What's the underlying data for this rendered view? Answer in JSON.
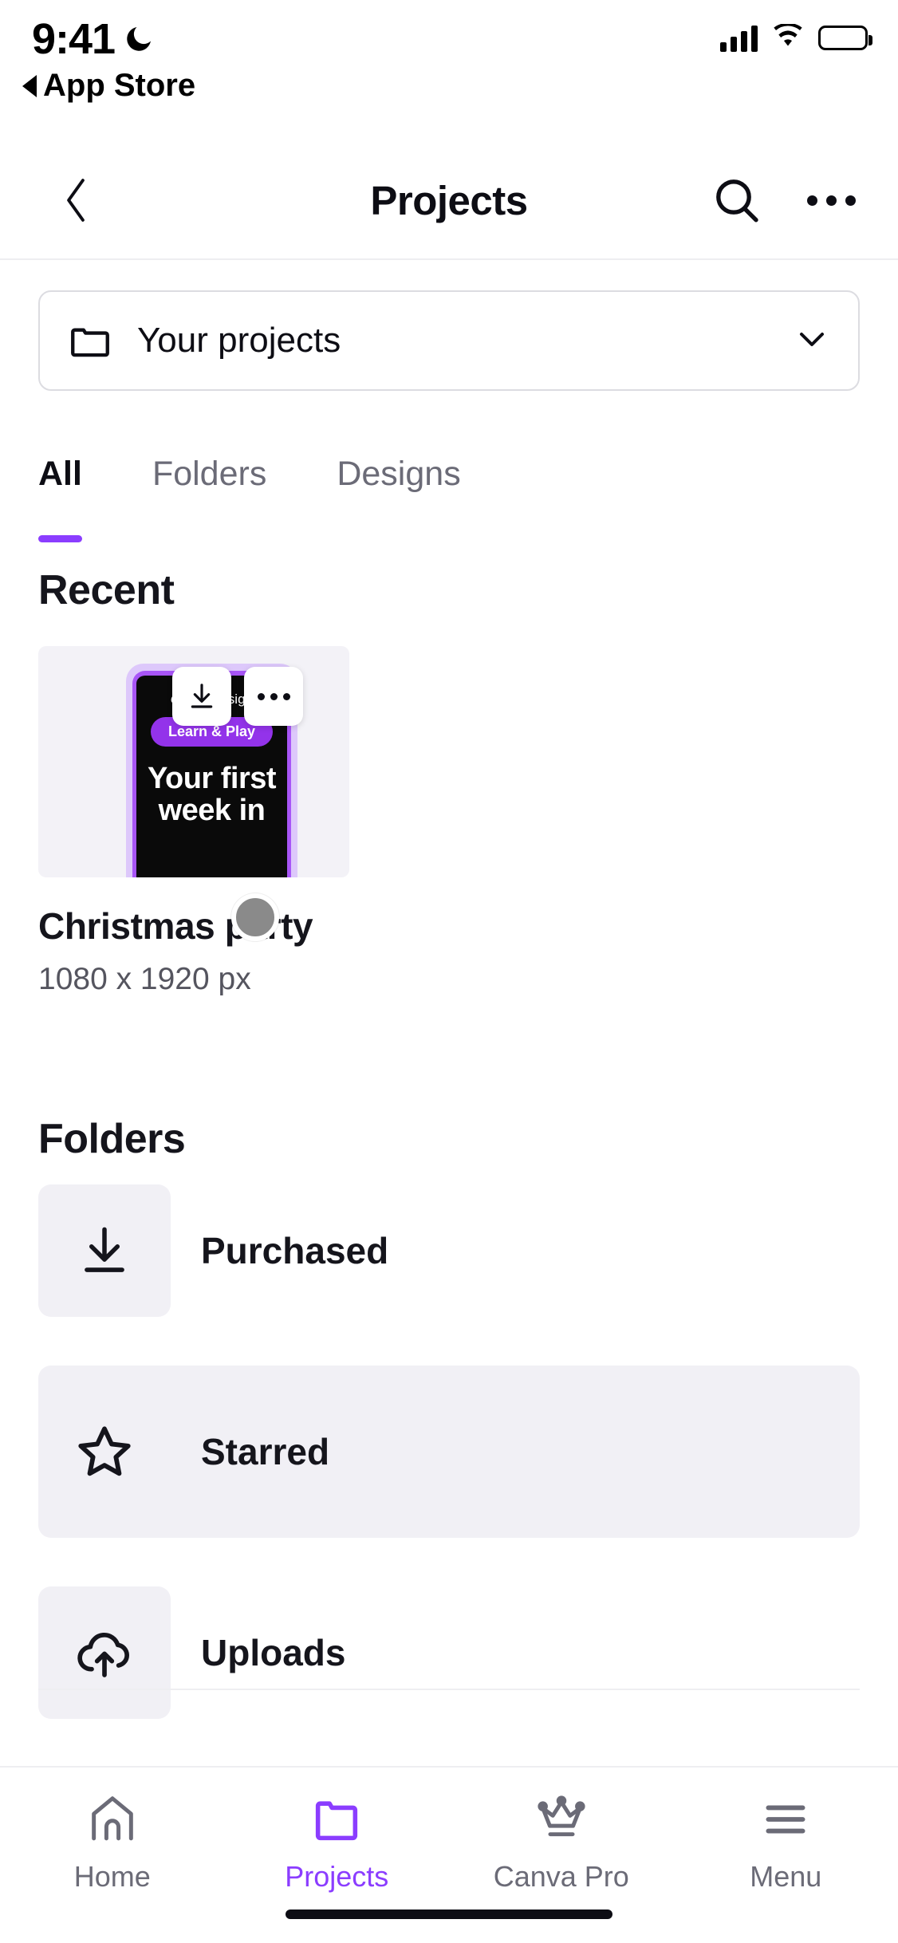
{
  "status_bar": {
    "time": "9:41",
    "dnd_icon": "crescent-moon-icon",
    "back_label": "App Store",
    "signal_icon": "cellular-signal-icon",
    "wifi_icon": "wifi-icon",
    "battery_icon": "battery-full-icon"
  },
  "header": {
    "back_icon": "chevron-left-icon",
    "title": "Projects",
    "search_icon": "search-icon",
    "more_icon": "more-horizontal-icon"
  },
  "dropdown": {
    "icon": "folder-icon",
    "label": "Your projects",
    "chevron_icon": "chevron-down-icon"
  },
  "tabs": [
    {
      "label": "All",
      "active": true
    },
    {
      "label": "Folders",
      "active": false
    },
    {
      "label": "Designs",
      "active": false
    }
  ],
  "recent": {
    "section_title": "Recent",
    "card": {
      "title": "Christmas party",
      "dimensions": "1080 x 1920 px",
      "download_icon": "download-icon",
      "more_icon": "more-horizontal-icon",
      "thumbnail": {
        "brand_italic": "Canva",
        "brand_rest": " Design",
        "pill_label": "Learn & Play",
        "headline_line1": "Your first",
        "headline_line2": "week in"
      }
    }
  },
  "folders": {
    "section_title": "Folders",
    "items": [
      {
        "label": "Purchased",
        "icon": "download-icon",
        "selected": false
      },
      {
        "label": "Starred",
        "icon": "star-icon",
        "selected": true
      },
      {
        "label": "Uploads",
        "icon": "cloud-upload-icon",
        "selected": false
      }
    ]
  },
  "bottom_nav": [
    {
      "label": "Home",
      "icon": "home-icon",
      "active": false
    },
    {
      "label": "Projects",
      "icon": "folder-icon",
      "active": true
    },
    {
      "label": "Canva Pro",
      "icon": "crown-icon",
      "active": false
    },
    {
      "label": "Menu",
      "icon": "hamburger-menu-icon",
      "active": false
    }
  ],
  "colors": {
    "accent_purple": "#8b3dff",
    "text_dark": "#15151c",
    "text_muted": "#6b6b77",
    "surface_gray": "#f1f0f5"
  }
}
